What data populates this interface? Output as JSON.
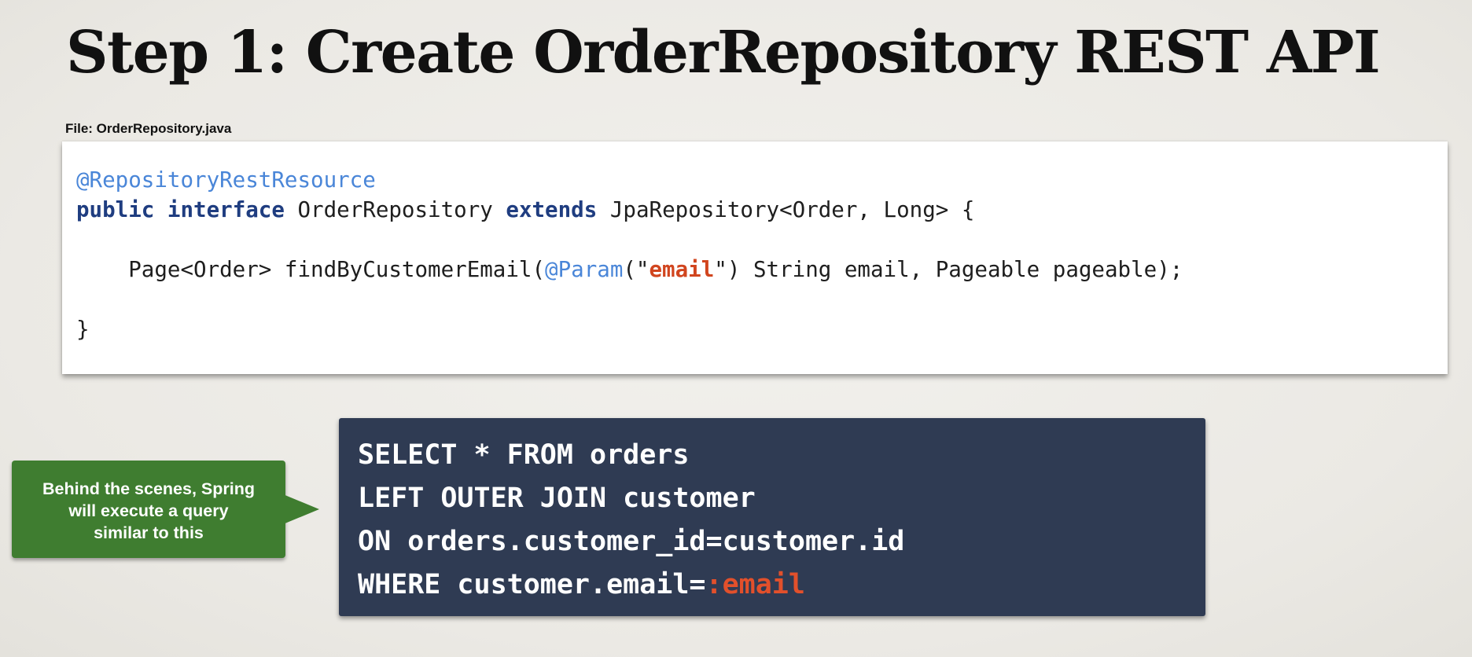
{
  "slide": {
    "title": "Step 1: Create OrderRepository REST API",
    "file_label": "File: OrderRepository.java"
  },
  "code": {
    "annotation": "@RepositoryRestResource",
    "kw_public": "public",
    "kw_interface": "interface",
    "name": " OrderRepository ",
    "kw_extends": "extends",
    "extends_rest": " JpaRepository<Order, Long> {",
    "method_prefix": "    Page<Order> findByCustomerEmail(",
    "param_annotation": "@Param",
    "paren_open": "(\"",
    "param_value": "email",
    "method_suffix": "\") String email, Pageable pageable);",
    "closing": "}"
  },
  "callout": {
    "lines": [
      "Behind the scenes, Spring",
      "will execute a query",
      "similar to this"
    ]
  },
  "sql": {
    "line1": "SELECT * FROM orders",
    "line2": "LEFT OUTER JOIN customer",
    "line3": "ON orders.customer_id=customer.id",
    "line4_prefix": "WHERE customer.email=",
    "line4_param": ":email"
  },
  "colors": {
    "annotation": "#4a86d8",
    "keyword": "#1f3d80",
    "string": "#d1451e",
    "callout_bg": "#3f7d30",
    "sql_bg": "#2f3b53",
    "sql_param": "#e2502b"
  }
}
